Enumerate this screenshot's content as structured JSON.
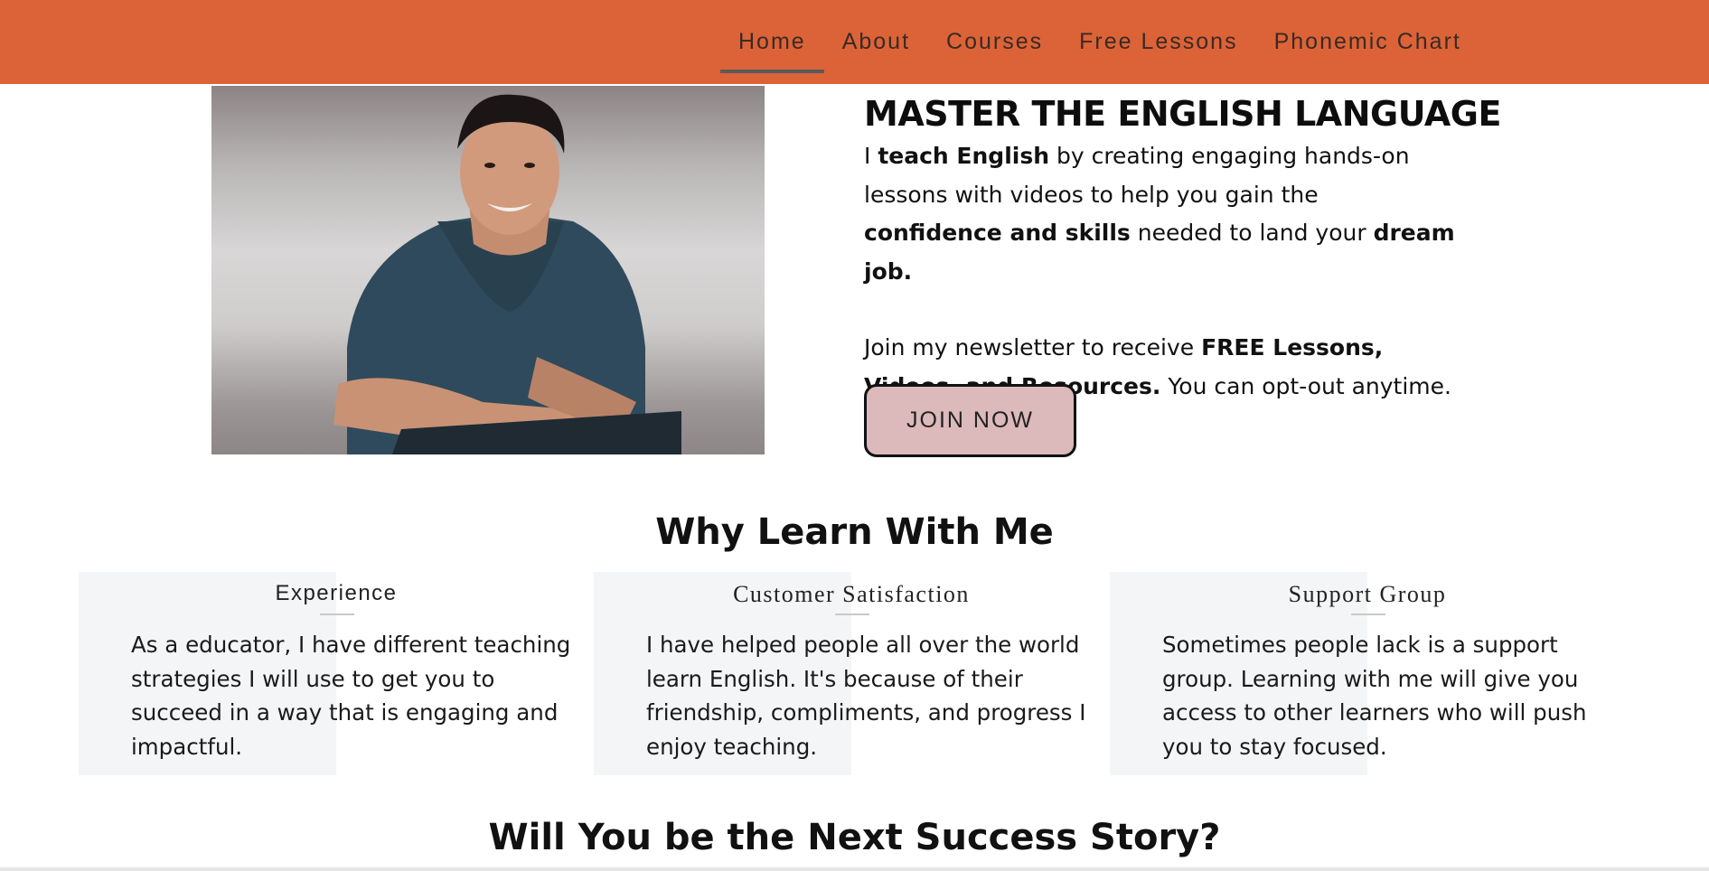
{
  "nav": {
    "items": [
      {
        "label": "Home"
      },
      {
        "label": "About"
      },
      {
        "label": "Courses"
      },
      {
        "label": "Free Lessons"
      },
      {
        "label": "Phonemic Chart"
      }
    ],
    "active": "Home"
  },
  "hero": {
    "title": "MASTER THE ENGLISH LANGUAGE",
    "p1": {
      "t1": "I ",
      "b1": "teach English",
      "t2": " by creating engaging hands-on lessons with videos to help you gain the ",
      "b2": "confidence and skills",
      "t3": " needed to land your ",
      "b3": "dream job."
    },
    "p2": {
      "t1": "Join my newsletter to receive ",
      "b1": "FREE  Lessons, Videos, and Resources.",
      "t2": " You can opt-out anytime."
    },
    "button_label": "JOIN NOW"
  },
  "why": {
    "title": "Why Learn With Me",
    "cards": [
      {
        "title": "Experience",
        "text": "As a educator, I have different teaching strategies I will use to get you to succeed in a way that is engaging and impactful."
      },
      {
        "title": "Customer Satisfaction",
        "text": "I have helped people all over the world learn English. It's because of their friendship, compliments, and progress I enjoy teaching."
      },
      {
        "title": "Support Group",
        "text": "Sometimes people lack is a support group. Learning with me will give you access to other learners who will push you to stay focused."
      }
    ]
  },
  "next_title": "Will You be the Next Success Story?",
  "colors": {
    "header": "#dc6337",
    "button_bg": "#dcb9bb",
    "card_bg": "#f4f5f7"
  }
}
